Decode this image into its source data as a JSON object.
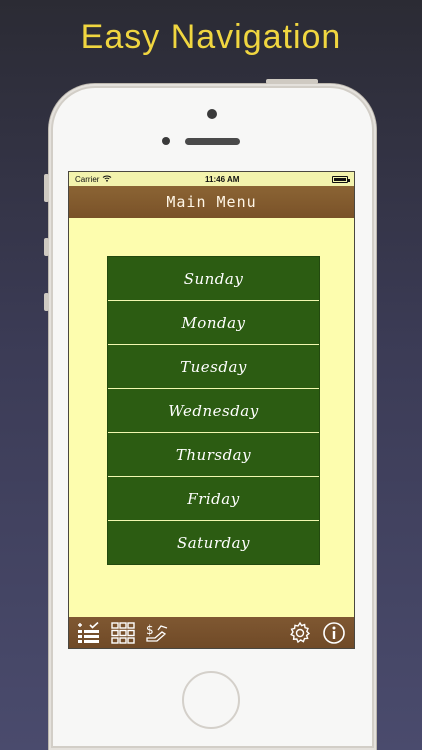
{
  "promo": {
    "headline": "Easy Navigation"
  },
  "statusbar": {
    "carrier": "Carrier",
    "time": "11:46 AM"
  },
  "navbar": {
    "title": "Main Menu"
  },
  "menu": {
    "items": [
      {
        "label": "Sunday"
      },
      {
        "label": "Monday"
      },
      {
        "label": "Tuesday"
      },
      {
        "label": "Wednesday"
      },
      {
        "label": "Thursday"
      },
      {
        "label": "Friday"
      },
      {
        "label": "Saturday"
      }
    ]
  },
  "tabbar": {
    "left_icons": [
      "checklist-icon",
      "grid-icon",
      "payment-check-icon"
    ],
    "right_icons": [
      "gear-icon",
      "info-icon"
    ]
  },
  "colors": {
    "screen_background": "#fdfdae",
    "bar_brown": "#7c5530",
    "menu_green": "#2c5c12",
    "headline_yellow": "#f0d640"
  }
}
